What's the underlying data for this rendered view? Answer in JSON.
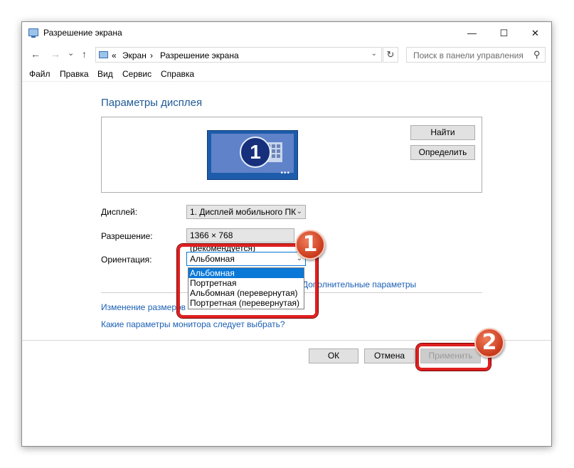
{
  "window": {
    "title": "Разрешение экрана",
    "controls": {
      "minimize": "—",
      "maximize": "☐",
      "close": "✕"
    }
  },
  "address_bar": {
    "back_icon": "←",
    "forward_icon": "→",
    "recent_icon": "⌄",
    "up_icon": "↑",
    "prefix": "«",
    "crumb1": "Экран",
    "separator": "›",
    "crumb2": "Разрешение экрана",
    "dropdown": "⌄",
    "refresh": "↻",
    "search_placeholder": "Поиск в панели управления",
    "search_icon": "⚲"
  },
  "menu": {
    "file": "Файл",
    "edit": "Правка",
    "view": "Вид",
    "service": "Сервис",
    "help": "Справка"
  },
  "main": {
    "section_title": "Параметры дисплея",
    "monitor_number": "1",
    "monitor_dots": "•••",
    "find_button": "Найти",
    "identify_button": "Определить",
    "display_label": "Дисплей:",
    "display_value": "1. Дисплей мобильного ПК",
    "resolution_label": "Разрешение:",
    "resolution_value": "1366 × 768 (рекомендуется)",
    "orientation_label": "Ориентация:",
    "orientation_value": "Альбомная",
    "chevron": "⌄",
    "orientation_options": [
      "Альбомная",
      "Портретная",
      "Альбомная (перевернутая)",
      "Портретная (перевернутая)"
    ],
    "advanced_link": "Дополнительные параметры",
    "resize_link_start": "Изменение размеров",
    "monitor_choice_link": "Какие параметры монитора следует выбрать?"
  },
  "buttons": {
    "ok": "ОК",
    "cancel": "Отмена",
    "apply": "Применить"
  },
  "annotations": {
    "badge1": "1",
    "badge2": "2",
    "accent_color": "#e02020"
  }
}
